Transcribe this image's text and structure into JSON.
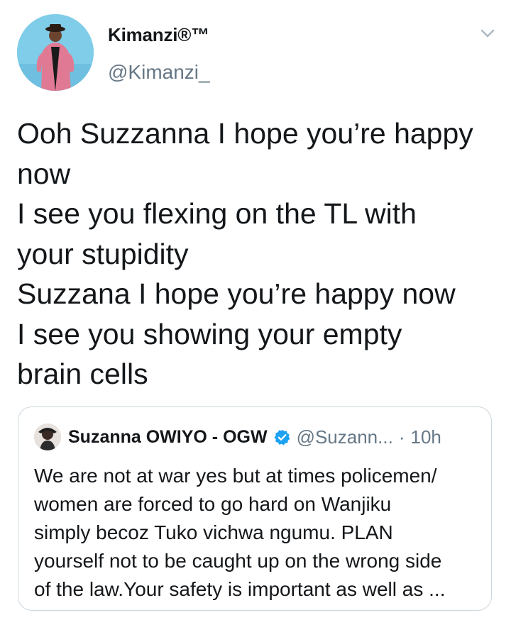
{
  "tweet": {
    "display_name": "Kimanzi®™",
    "handle": "@Kimanzi_",
    "text_lines": [
      "Ooh Suzzanna I hope you’re happy",
      "now",
      "I see you flexing on the TL with",
      "your stupidity",
      "Suzzana I hope you’re happy now",
      "I see you showing your empty",
      "brain cells"
    ],
    "menu_icon": "chevron-down-icon"
  },
  "quoted_tweet": {
    "display_name": "Suzanna OWIYO - OGW",
    "verified_icon": "verified-badge-icon",
    "handle": "@Suzann...",
    "separator": "·",
    "time": "10h",
    "text_lines": [
      "We are not at war yes but at times policemen/",
      "women are forced to go hard on Wanjiku",
      "simply becoz Tuko vichwa ngumu. PLAN",
      "yourself not to be caught up on the wrong side",
      "of the law.Your safety is important as well as ..."
    ]
  },
  "colors": {
    "text_primary": "#14171a",
    "text_secondary": "#657786",
    "border": "#ccd6dd",
    "verified": "#1da1f2",
    "avatar_bg": "#7fcde8"
  }
}
